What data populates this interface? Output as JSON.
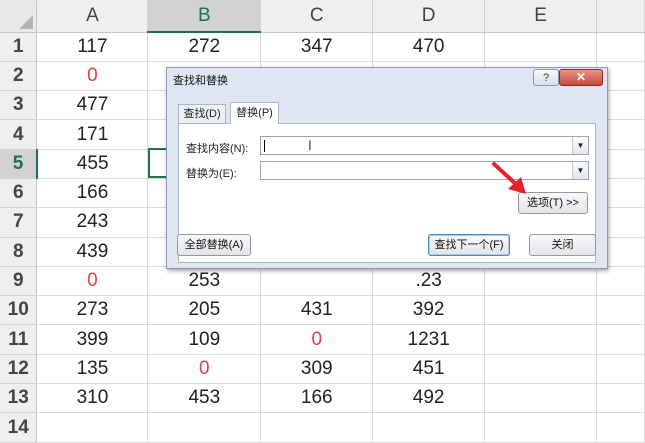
{
  "sheet": {
    "columns": [
      "A",
      "B",
      "C",
      "D",
      "E"
    ],
    "selected_column": "B",
    "selected_row": "5",
    "rows": [
      {
        "num": "1",
        "cells": [
          {
            "v": "117"
          },
          {
            "v": "272"
          },
          {
            "v": "347"
          },
          {
            "v": "470"
          },
          {
            "v": ""
          }
        ]
      },
      {
        "num": "2",
        "cells": [
          {
            "v": "0",
            "red": true
          },
          {
            "v": ""
          },
          {
            "v": ""
          },
          {
            "v": ""
          },
          {
            "v": ""
          }
        ]
      },
      {
        "num": "3",
        "cells": [
          {
            "v": "477"
          },
          {
            "v": ""
          },
          {
            "v": ""
          },
          {
            "v": ""
          },
          {
            "v": ""
          }
        ]
      },
      {
        "num": "4",
        "cells": [
          {
            "v": "171"
          },
          {
            "v": ""
          },
          {
            "v": ""
          },
          {
            "v": ""
          },
          {
            "v": ""
          }
        ]
      },
      {
        "num": "5",
        "cells": [
          {
            "v": "455"
          },
          {
            "v": ""
          },
          {
            "v": ""
          },
          {
            "v": ""
          },
          {
            "v": ""
          }
        ]
      },
      {
        "num": "6",
        "cells": [
          {
            "v": "166"
          },
          {
            "v": ""
          },
          {
            "v": ""
          },
          {
            "v": ""
          },
          {
            "v": ""
          }
        ]
      },
      {
        "num": "7",
        "cells": [
          {
            "v": "243"
          },
          {
            "v": ""
          },
          {
            "v": ""
          },
          {
            "v": ""
          },
          {
            "v": ""
          }
        ]
      },
      {
        "num": "8",
        "cells": [
          {
            "v": "439"
          },
          {
            "v": ""
          },
          {
            "v": ""
          },
          {
            "v": ""
          },
          {
            "v": ""
          }
        ]
      },
      {
        "num": "9",
        "cells": [
          {
            "v": "0",
            "red": true
          },
          {
            "v": "253"
          },
          {
            "v": ""
          },
          {
            "v": ".23"
          },
          {
            "v": ""
          }
        ]
      },
      {
        "num": "10",
        "cells": [
          {
            "v": "273"
          },
          {
            "v": "205"
          },
          {
            "v": "431"
          },
          {
            "v": "392"
          },
          {
            "v": ""
          }
        ]
      },
      {
        "num": "11",
        "cells": [
          {
            "v": "399"
          },
          {
            "v": "109"
          },
          {
            "v": "0",
            "red": true
          },
          {
            "v": "1231"
          },
          {
            "v": ""
          }
        ]
      },
      {
        "num": "12",
        "cells": [
          {
            "v": "135"
          },
          {
            "v": "0",
            "red": true
          },
          {
            "v": "309"
          },
          {
            "v": "451"
          },
          {
            "v": ""
          }
        ]
      },
      {
        "num": "13",
        "cells": [
          {
            "v": "310"
          },
          {
            "v": "453"
          },
          {
            "v": "166"
          },
          {
            "v": "492"
          },
          {
            "v": ""
          }
        ]
      },
      {
        "num": "14",
        "cells": [
          {
            "v": ""
          },
          {
            "v": ""
          },
          {
            "v": ""
          },
          {
            "v": ""
          },
          {
            "v": ""
          }
        ]
      }
    ]
  },
  "dialog": {
    "title": "查找和替换",
    "help_label": "?",
    "close_label": "✕",
    "tabs": {
      "find": "查找(D)",
      "replace": "替换(P)"
    },
    "find_label": "查找内容(N):",
    "find_value": "",
    "replace_label": "替换为(E):",
    "replace_value": "",
    "dropdown_glyph": "▼",
    "ibeam_glyph": "Ⅰ",
    "options_button": "选项(T) >>",
    "replace_all_button": "全部替换(A)",
    "find_next_button": "查找下一个(F)",
    "close_button": "关闭"
  },
  "colors": {
    "accent_green": "#217346",
    "zero_red": "#e04040",
    "arrow_red": "#e8212a"
  }
}
